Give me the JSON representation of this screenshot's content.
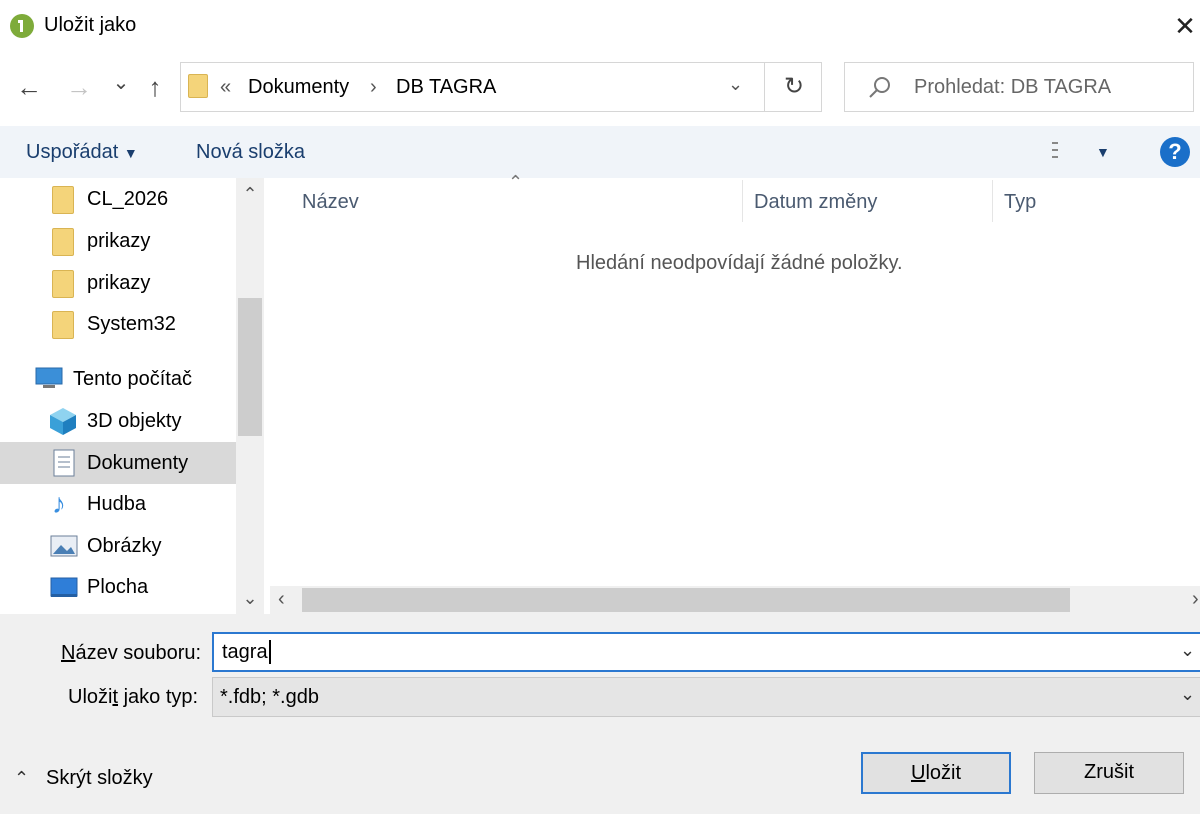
{
  "window": {
    "title": "Uložit jako",
    "close": "✕"
  },
  "nav": {
    "back": "←",
    "forward": "→",
    "recent": "⌄",
    "up": "↑",
    "breadcrumb_prefix": "«",
    "breadcrumb": [
      "Dokumenty",
      "DB TAGRA"
    ],
    "breadcrumb_sep": "›",
    "refresh": "↻",
    "search_placeholder": "Prohledat: DB TAGRA"
  },
  "toolbar": {
    "organize": "Uspořádat",
    "new_folder": "Nová složka",
    "help": "?"
  },
  "sidebar": {
    "folders": [
      "CL_2026",
      "prikazy",
      "prikazy",
      "System32"
    ],
    "computer": "Tento počítač",
    "items": [
      "3D objekty",
      "Dokumenty",
      "Hudba",
      "Obrázky",
      "Plocha"
    ],
    "selected": "Dokumenty"
  },
  "list": {
    "columns": [
      "Název",
      "Datum změny",
      "Typ"
    ],
    "empty_message": "Hledání neodpovídají žádné položky."
  },
  "form": {
    "filename_label_pre": "N",
    "filename_label_ul": "á",
    "filename_label_post": "zev souboru:",
    "filename_value": "tagra",
    "type_label_pre": "Uloži",
    "type_label_ul": "t",
    "type_label_post": " jako typ:",
    "type_value": "*.fdb; *.gdb"
  },
  "footer": {
    "hide_folders": "Skrýt složky",
    "save_pre": "",
    "save_ul": "U",
    "save_post": "ložit",
    "cancel": "Zrušit"
  },
  "colors": {
    "accent": "#2b78d0",
    "folder": "#f4d47a",
    "selection": "#d9d9d9",
    "toolbar_bg": "#f0f4f9"
  }
}
